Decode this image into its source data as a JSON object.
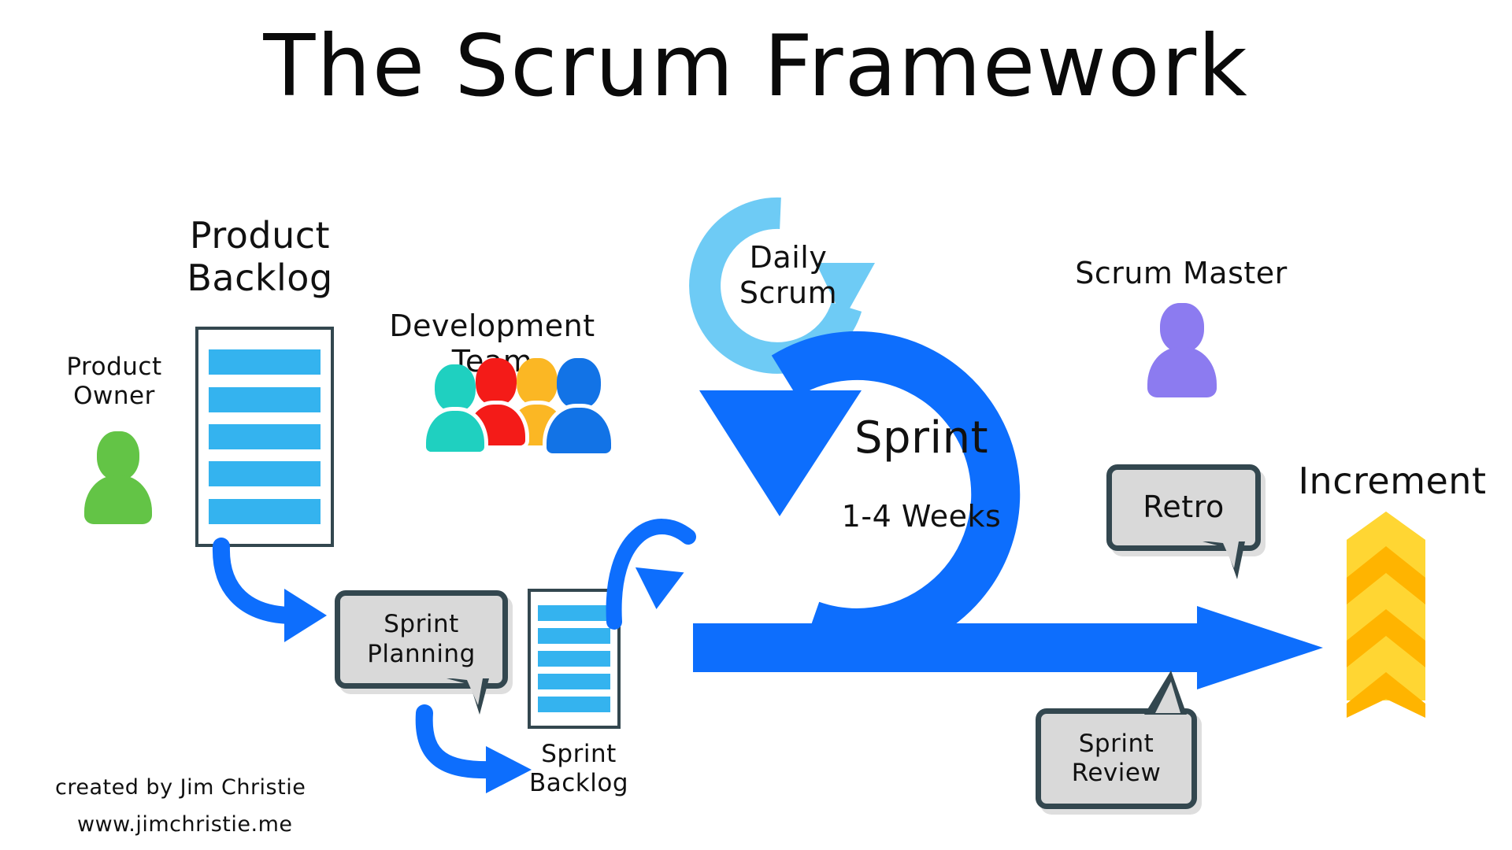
{
  "title": "The Scrum Framework",
  "roles": {
    "product_owner": {
      "label": "Product\nOwner",
      "color": "#63c446"
    },
    "scrum_master": {
      "label": "Scrum Master",
      "color": "#8c7bf0"
    },
    "development_team": {
      "label": "Development Team",
      "member_colors": [
        "#1fd0c0",
        "#f41b18",
        "#fbb724",
        "#1273e6"
      ]
    }
  },
  "artifacts": {
    "product_backlog": {
      "label": "Product\nBacklog",
      "items": 5,
      "item_color": "#34b3ef",
      "border_color": "#33474f"
    },
    "sprint_backlog": {
      "label": "Sprint\nBacklog",
      "items": 5,
      "item_color": "#34b3ef",
      "border_color": "#33474f"
    },
    "increment": {
      "label": "Increment",
      "chevrons": 5,
      "colors": [
        "#ffd633",
        "#ffb400"
      ]
    }
  },
  "events": {
    "sprint": {
      "label": "Sprint",
      "duration": "1-4 Weeks",
      "color": "#0d6efd"
    },
    "daily_scrum": {
      "label": "Daily\nScrum",
      "color": "#6ecbf5"
    },
    "sprint_planning": {
      "label": "Sprint\nPlanning"
    },
    "retro": {
      "label": "Retro"
    },
    "sprint_review": {
      "label": "Sprint\nReview"
    }
  },
  "credits": {
    "author": "created by Jim Christie",
    "website": "www.jimchristie.me"
  },
  "colors": {
    "accent_blue": "#0d6efd",
    "light_blue": "#6ecbf5",
    "item_blue": "#34b3ef",
    "slate": "#33474f",
    "bubble_fill": "#d9d9d9",
    "yellow": "#ffd633",
    "orange": "#ffb400",
    "green": "#63c446",
    "purple": "#8c7bf0"
  }
}
